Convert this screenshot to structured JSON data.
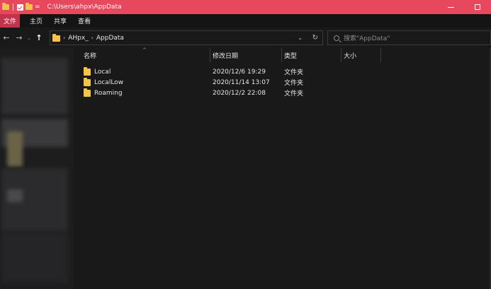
{
  "window": {
    "title": "C:\\Users\\ahpx\\AppData"
  },
  "ribbon": {
    "tabs": [
      {
        "label": "文件"
      },
      {
        "label": "主页"
      },
      {
        "label": "共享"
      },
      {
        "label": "查看"
      }
    ]
  },
  "address": {
    "crumbs": [
      "AHpx_",
      "AppData"
    ]
  },
  "search": {
    "placeholder": "搜索\"AppData\""
  },
  "columns": {
    "name": "名称",
    "date": "修改日期",
    "type": "类型",
    "size": "大小"
  },
  "files": [
    {
      "name": "Local",
      "date": "2020/12/6 19:29",
      "type": "文件夹"
    },
    {
      "name": "LocalLow",
      "date": "2020/11/14 13:07",
      "type": "文件夹"
    },
    {
      "name": "Roaming",
      "date": "2020/12/2 22:08",
      "type": "文件夹"
    }
  ],
  "colors": {
    "titlebar": "#e8485d",
    "file_tab": "#c4334c",
    "folder": "#f3c44d"
  }
}
